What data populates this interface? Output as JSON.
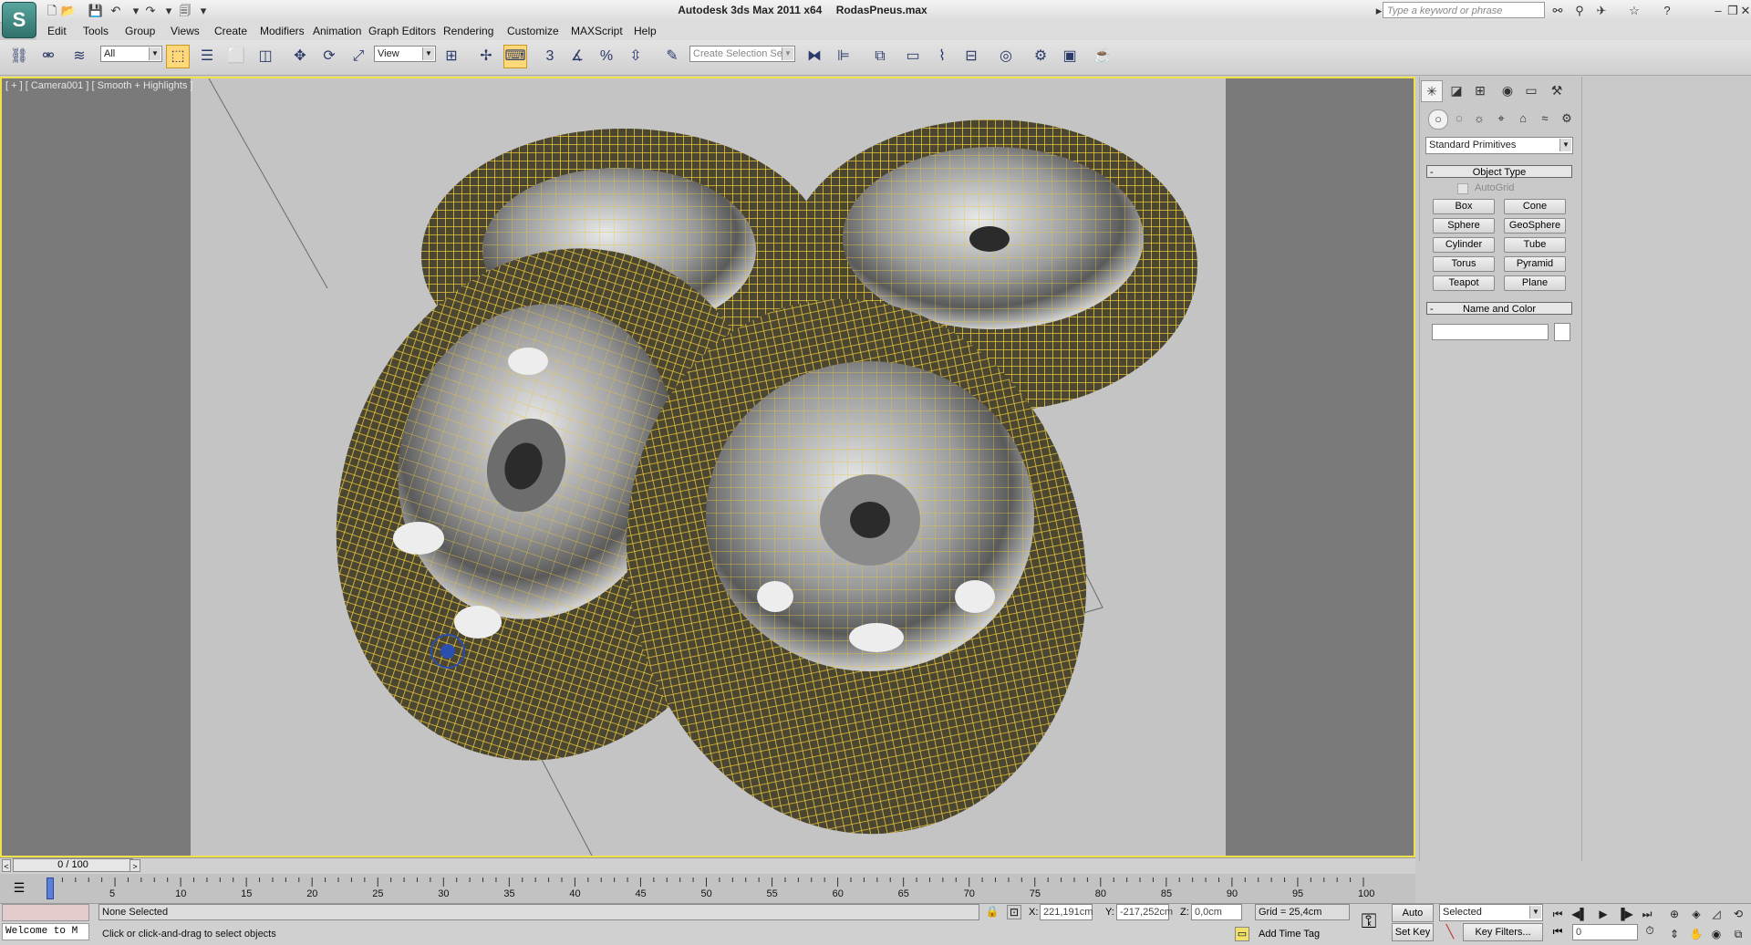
{
  "titlebar": {
    "app_name": "Autodesk 3ds Max  2011 x64",
    "file_name": "RodasPneus.max",
    "search_placeholder": "Type a keyword or phrase"
  },
  "menu": [
    "Edit",
    "Tools",
    "Group",
    "Views",
    "Create",
    "Modifiers",
    "Animation",
    "Graph Editors",
    "Rendering",
    "Customize",
    "MAXScript",
    "Help"
  ],
  "toolbar": {
    "selection_filter": "All",
    "reference_coord": "View",
    "snap_label": "3",
    "named_selection_placeholder": "Create Selection Se"
  },
  "viewport": {
    "label": "[ + ] [ Camera001 ] [ Smooth + Highlights ]"
  },
  "command_panel": {
    "category": "Standard Primitives",
    "object_type_title": "Object Type",
    "autogrid_label": "AutoGrid",
    "primitives": [
      "Box",
      "Cone",
      "Sphere",
      "GeoSphere",
      "Cylinder",
      "Tube",
      "Torus",
      "Pyramid",
      "Teapot",
      "Plane"
    ],
    "name_color_title": "Name and Color",
    "object_name": ""
  },
  "timeline": {
    "frame_display": "0 / 100",
    "ticks": [
      "5",
      "10",
      "15",
      "20",
      "25",
      "30",
      "35",
      "40",
      "45",
      "50",
      "55",
      "60",
      "65",
      "70",
      "75",
      "80",
      "85",
      "90",
      "95",
      "100"
    ]
  },
  "status": {
    "maxscript_listener": "Welcome to M",
    "selection_status": "None Selected",
    "prompt": "Click or click-and-drag to select objects",
    "x_label": "X:",
    "x_value": "221,191cm",
    "y_label": "Y:",
    "y_value": "-217,252cm",
    "z_label": "Z:",
    "z_value": "0,0cm",
    "grid": "Grid = 25,4cm",
    "add_time_tag": "Add Time Tag",
    "auto_key": "Auto Key",
    "set_key": "Set Key",
    "key_mode": "Selected",
    "key_filters": "Key Filters...",
    "current_frame": "0"
  },
  "colors": {
    "wireframe": "#e8c63a",
    "viewport_border": "#f0e04a",
    "viewport_bg": "#c4c4c4"
  }
}
